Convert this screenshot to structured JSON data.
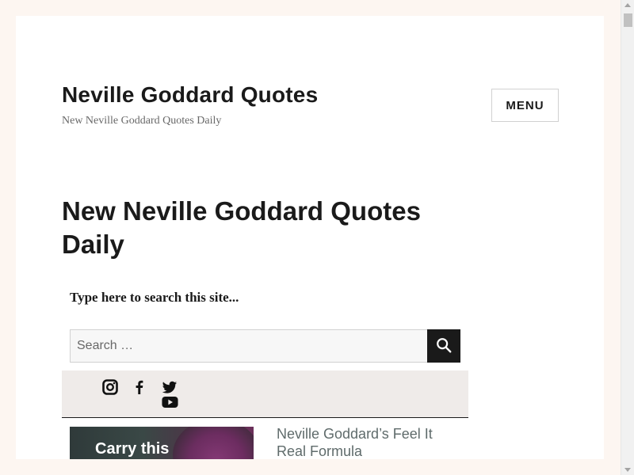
{
  "header": {
    "site_title": "Neville Goddard Quotes",
    "tagline": "New Neville Goddard Quotes Daily",
    "menu_label": "MENU"
  },
  "main": {
    "page_title": "New Neville Goddard Quotes Daily",
    "search": {
      "label": "Type here to search this site...",
      "placeholder": "Search …",
      "value": ""
    },
    "social_icons": [
      "instagram-icon",
      "facebook-icon",
      "twitter-icon",
      "youtube-icon"
    ],
    "post": {
      "thumbnail_text": "Carry this",
      "title": "Neville Goddard’s Feel It Real Formula"
    }
  },
  "colors": {
    "background": "#fdf6f1",
    "text": "#1a1a1a",
    "social_bar": "#efebe9",
    "post_title": "#5f6b6b"
  }
}
